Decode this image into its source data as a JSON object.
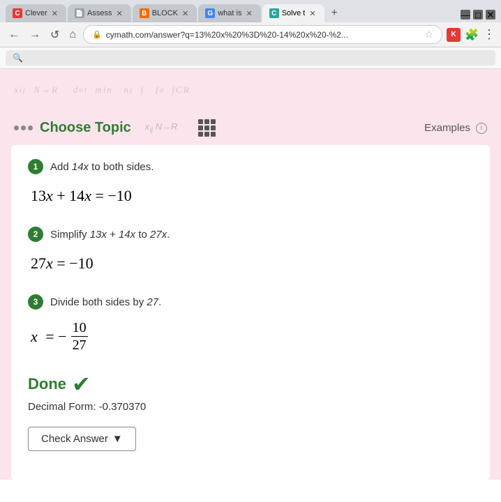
{
  "browser": {
    "tabs": [
      {
        "id": "tab-clever",
        "favicon_color": "#e53935",
        "favicon_letter": "C",
        "title": "Clever",
        "active": false
      },
      {
        "id": "tab-assess",
        "favicon_color": "#9e9e9e",
        "favicon_letter": "A",
        "title": "Assess",
        "active": false
      },
      {
        "id": "tab-block",
        "favicon_color": "#ef6c00",
        "favicon_letter": "B",
        "title": "BLOCK",
        "active": false
      },
      {
        "id": "tab-whatis",
        "favicon_color": "#4285f4",
        "favicon_letter": "G",
        "title": "what is",
        "active": false
      },
      {
        "id": "tab-solve",
        "favicon_color": "#26a69a",
        "favicon_letter": "C",
        "title": "Solve t",
        "active": true
      }
    ],
    "add_tab_label": "+",
    "address": "cymath.com/answer?q=13%20x%20%3D%20-14%20x%20-%2...",
    "nav_back": "←",
    "nav_forward": "→",
    "nav_refresh": "↺",
    "nav_home": "⌂"
  },
  "header": {
    "choose_topic": "Choose Topic",
    "examples": "Examples",
    "info": "i"
  },
  "steps": [
    {
      "number": "1",
      "description_parts": [
        "Add ",
        "14x",
        " to both sides."
      ],
      "expression": "13x + 14x = −10"
    },
    {
      "number": "2",
      "description_parts": [
        "Simplify ",
        "13x + 14x",
        " to ",
        "27x",
        "."
      ],
      "expression": "27x = −10"
    },
    {
      "number": "3",
      "description_parts": [
        "Divide both sides by ",
        "27",
        "."
      ],
      "expression_parts": {
        "prefix": "x = −",
        "numerator": "10",
        "denominator": "27"
      }
    }
  ],
  "done": {
    "label": "Done",
    "decimal_label": "Decimal Form:",
    "decimal_value": "-0.370370",
    "check_answer_label": "Check Answer",
    "check_answer_arrow": "▼"
  }
}
